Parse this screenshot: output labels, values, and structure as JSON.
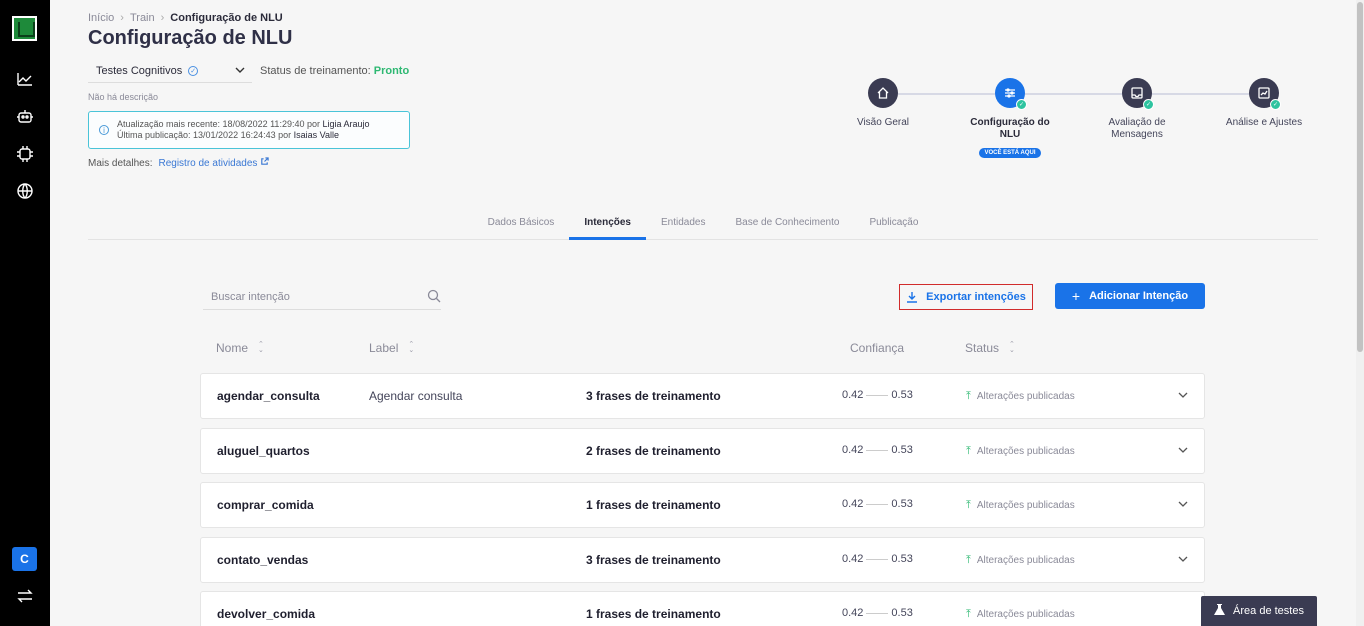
{
  "breadcrumb": {
    "home": "Início",
    "train": "Train",
    "current": "Configuração de NLU"
  },
  "page_title": "Configuração de NLU",
  "bot_select": {
    "value": "Testes Cognitivos"
  },
  "training_status": {
    "label": "Status de treinamento:",
    "value": "Pronto"
  },
  "no_description": "Não há descrição",
  "info": {
    "line1_prefix": "Atualização mais recente: 18/08/2022 11:29:40 por ",
    "line1_user": "Ligia Araujo",
    "line2_prefix": "Última publicação: 13/01/2022 16:24:43 por ",
    "line2_user": "Isaias Valle"
  },
  "more_details": {
    "label": "Mais detalhes:",
    "link": "Registro de atividades"
  },
  "stepper": {
    "steps": [
      {
        "label": "Visão Geral"
      },
      {
        "label": "Configuração do NLU",
        "badge": "VOCÊ ESTÁ AQUI"
      },
      {
        "label": "Avaliação de Mensagens"
      },
      {
        "label": "Análise e Ajustes"
      }
    ]
  },
  "tabs": [
    "Dados Básicos",
    "Intenções",
    "Entidades",
    "Base de Conhecimento",
    "Publicação"
  ],
  "search": {
    "placeholder": "Buscar intenção"
  },
  "actions": {
    "export": "Exportar intenções",
    "add": "Adicionar Intenção"
  },
  "table": {
    "headers": {
      "name": "Nome",
      "label": "Label",
      "confidence": "Confiança",
      "status": "Status"
    },
    "rows": [
      {
        "name": "agendar_consulta",
        "label": "Agendar consulta",
        "phrases": "3 frases de treinamento",
        "conf_min": "0.42",
        "conf_max": "0.53",
        "status": "Alterações publicadas"
      },
      {
        "name": "aluguel_quartos",
        "label": "",
        "phrases": "2 frases de treinamento",
        "conf_min": "0.42",
        "conf_max": "0.53",
        "status": "Alterações publicadas"
      },
      {
        "name": "comprar_comida",
        "label": "",
        "phrases": "1 frases de treinamento",
        "conf_min": "0.42",
        "conf_max": "0.53",
        "status": "Alterações publicadas"
      },
      {
        "name": "contato_vendas",
        "label": "",
        "phrases": "3 frases de treinamento",
        "conf_min": "0.42",
        "conf_max": "0.53",
        "status": "Alterações publicadas"
      },
      {
        "name": "devolver_comida",
        "label": "",
        "phrases": "1 frases de treinamento",
        "conf_min": "0.42",
        "conf_max": "0.53",
        "status": "Alterações publicadas"
      }
    ]
  },
  "sidebar": {
    "user_initial": "C"
  },
  "test_area": "Área de testes"
}
